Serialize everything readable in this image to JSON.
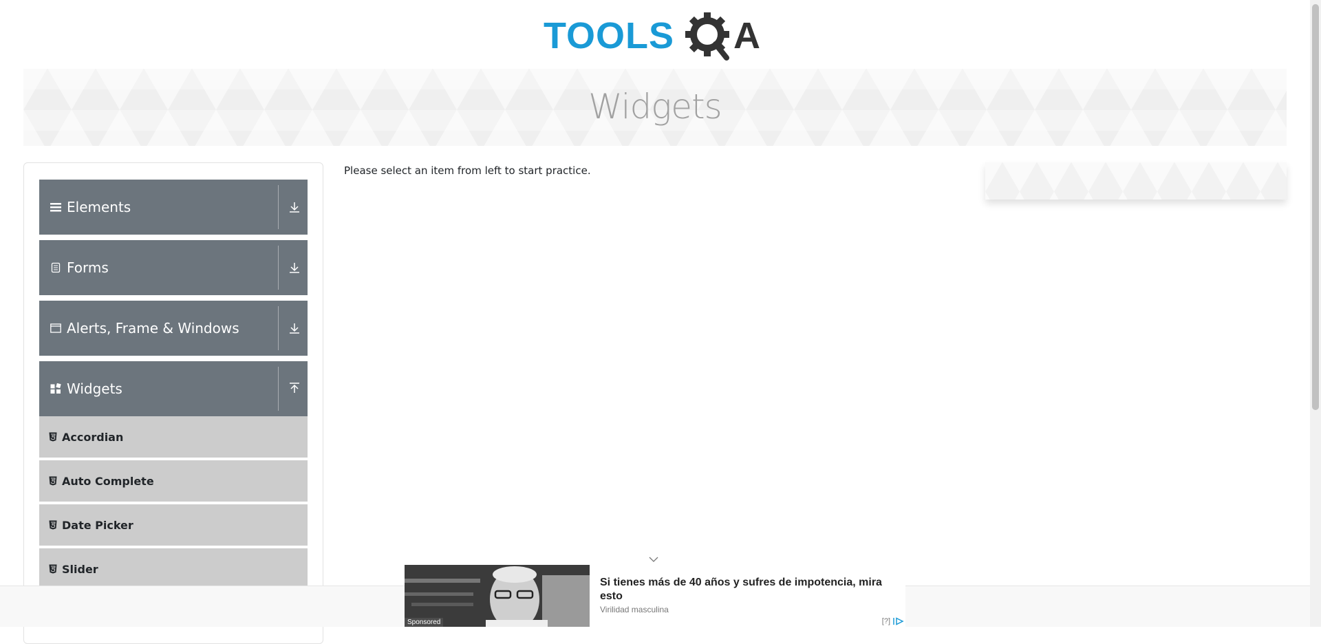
{
  "header": {
    "logo_part1": "TOOLS",
    "logo_part2": "A",
    "logo_alt": "TOOLSQA"
  },
  "banner": {
    "title": "Widgets"
  },
  "sidebar": {
    "groups": [
      {
        "label": "Elements",
        "icon": "hamburger-icon",
        "expanded": false
      },
      {
        "label": "Forms",
        "icon": "document-icon",
        "expanded": false
      },
      {
        "label": "Alerts, Frame & Windows",
        "icon": "window-icon",
        "expanded": false
      },
      {
        "label": "Widgets",
        "icon": "widgets-icon",
        "expanded": true
      }
    ],
    "widgets_items": [
      {
        "label": "Accordian",
        "icon": "html5-icon"
      },
      {
        "label": "Auto Complete",
        "icon": "html5-icon"
      },
      {
        "label": "Date Picker",
        "icon": "html5-icon"
      },
      {
        "label": "Slider",
        "icon": "html5-icon"
      }
    ]
  },
  "main": {
    "practice_text": "Please select an item from left to start practice."
  },
  "ad": {
    "sponsored": "Sponsored",
    "headline": "Si tienes más de 40 años y sufres de impotencia, mira esto",
    "source": "Virilidad masculina",
    "info": "[?]"
  },
  "colors": {
    "logo_blue": "#1a9ad6",
    "logo_dark": "#333333",
    "group_header_bg": "#6c757d",
    "menu_item_bg": "#cccccc",
    "banner_text": "#a1a1a1"
  }
}
